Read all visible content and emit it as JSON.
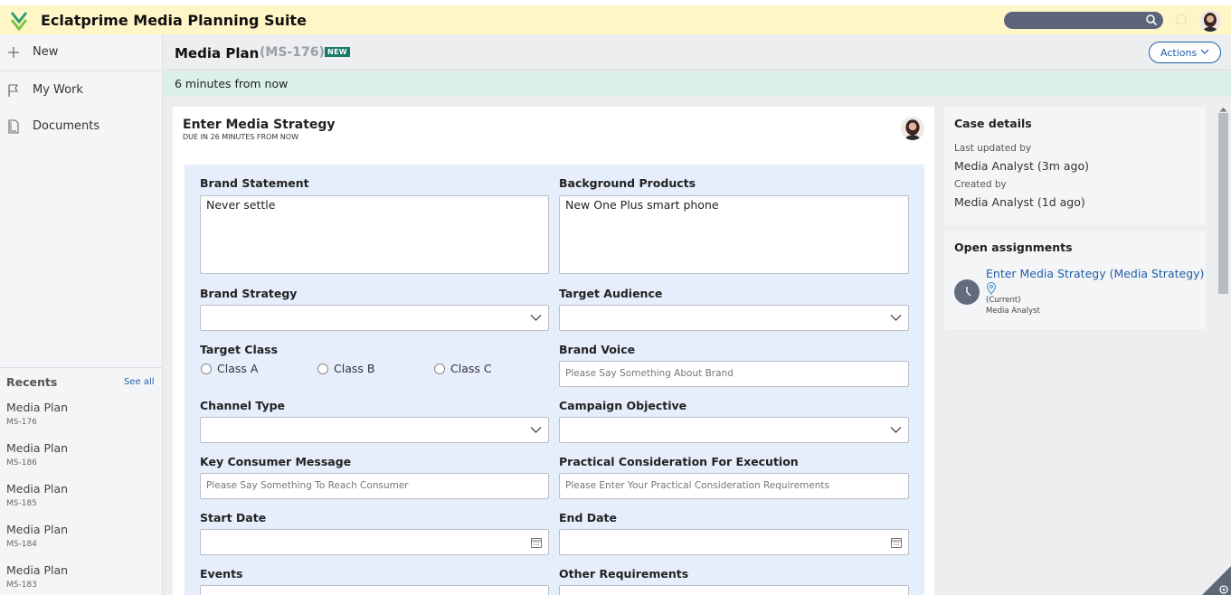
{
  "app": {
    "title": "Eclatprime Media Planning Suite"
  },
  "nav": [
    {
      "label": "New",
      "icon": "plus-icon"
    },
    {
      "label": "My Work",
      "icon": "flag-icon"
    },
    {
      "label": "Documents",
      "icon": "document-icon"
    }
  ],
  "recents": {
    "title": "Recents",
    "see_all": "See all",
    "items": [
      {
        "title": "Media Plan",
        "id": "MS-176"
      },
      {
        "title": "Media Plan",
        "id": "MS-186"
      },
      {
        "title": "Media Plan",
        "id": "MS-185"
      },
      {
        "title": "Media Plan",
        "id": "MS-184"
      },
      {
        "title": "Media Plan",
        "id": "MS-183"
      }
    ]
  },
  "header": {
    "title": "Media Plan",
    "case_id": "(MS-176)",
    "badge": "NEW",
    "actions_label": "Actions"
  },
  "banner": {
    "text": "6 minutes from now"
  },
  "task": {
    "title": "Enter Media Strategy",
    "due": "DUE IN 26 MINUTES FROM NOW"
  },
  "form": {
    "brand_statement": {
      "label": "Brand Statement",
      "value": "Never settle"
    },
    "background_products": {
      "label": "Background Products",
      "value": "New One Plus smart phone"
    },
    "brand_strategy": {
      "label": "Brand Strategy",
      "value": ""
    },
    "target_audience": {
      "label": "Target Audience",
      "value": ""
    },
    "target_class": {
      "label": "Target Class",
      "options": [
        "Class A",
        "Class B",
        "Class C"
      ]
    },
    "brand_voice": {
      "label": "Brand Voice",
      "placeholder": "Please Say Something About Brand"
    },
    "channel_type": {
      "label": "Channel Type",
      "value": ""
    },
    "campaign_objective": {
      "label": "Campaign Objective",
      "value": ""
    },
    "key_consumer_message": {
      "label": "Key Consumer Message",
      "placeholder": "Please Say Something To Reach Consumer"
    },
    "practical_consideration": {
      "label": "Practical Consideration For Execution",
      "placeholder": "Please Enter Your Practical Consideration Requirements"
    },
    "start_date": {
      "label": "Start Date",
      "value": ""
    },
    "end_date": {
      "label": "End Date",
      "value": ""
    },
    "events": {
      "label": "Events"
    },
    "other_requirements": {
      "label": "Other Requirements"
    }
  },
  "case_details": {
    "title": "Case details",
    "last_updated_label": "Last updated by",
    "last_updated_value": "Media Analyst (3m ago)",
    "created_label": "Created by",
    "created_value": "Media Analyst (1d ago)"
  },
  "assignments": {
    "title": "Open assignments",
    "link": "Enter Media Strategy (Media Strategy)",
    "status": "(Current)",
    "assignee": "Media Analyst"
  },
  "colors": {
    "accent": "#1f5fa8",
    "topbar": "#fff6c8",
    "banner": "#d9f1e6",
    "form_bg": "#e6edfb",
    "badge": "#197c6b"
  }
}
